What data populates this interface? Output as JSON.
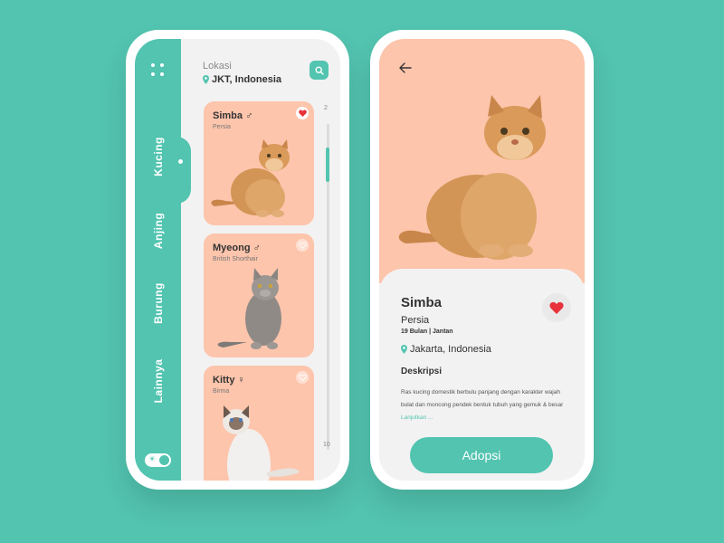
{
  "colors": {
    "accent": "#52c4b0",
    "card": "#fdc5ac",
    "heart": "#e8323c"
  },
  "list_screen": {
    "location_label": "Lokasi",
    "location_value": "JKT, Indonesia",
    "categories": [
      "Kucing",
      "Anjing",
      "Burung",
      "Lainnya"
    ],
    "scroll_start": "2",
    "scroll_end": "10",
    "pets": [
      {
        "name": "Simba",
        "gender": "♂",
        "breed": "Persia",
        "favorite": true
      },
      {
        "name": "Myeong",
        "gender": "♂",
        "breed": "British Shorthair",
        "favorite": false
      },
      {
        "name": "Kitty",
        "gender": "♀",
        "breed": "Birma",
        "favorite": false
      }
    ]
  },
  "detail_screen": {
    "name": "Simba",
    "breed": "Persia",
    "info": "19 Bulan | Jantan",
    "location": "Jakarta, Indonesia",
    "description_title": "Deskripsi",
    "description": "Ras kucing domestik berbulu panjang dengan karakter wajah bulat dan moncong pendek bentuk tubuh yang gemuk & besar",
    "read_more": "Lanjutkan ...",
    "adopt_label": "Adopsi"
  }
}
